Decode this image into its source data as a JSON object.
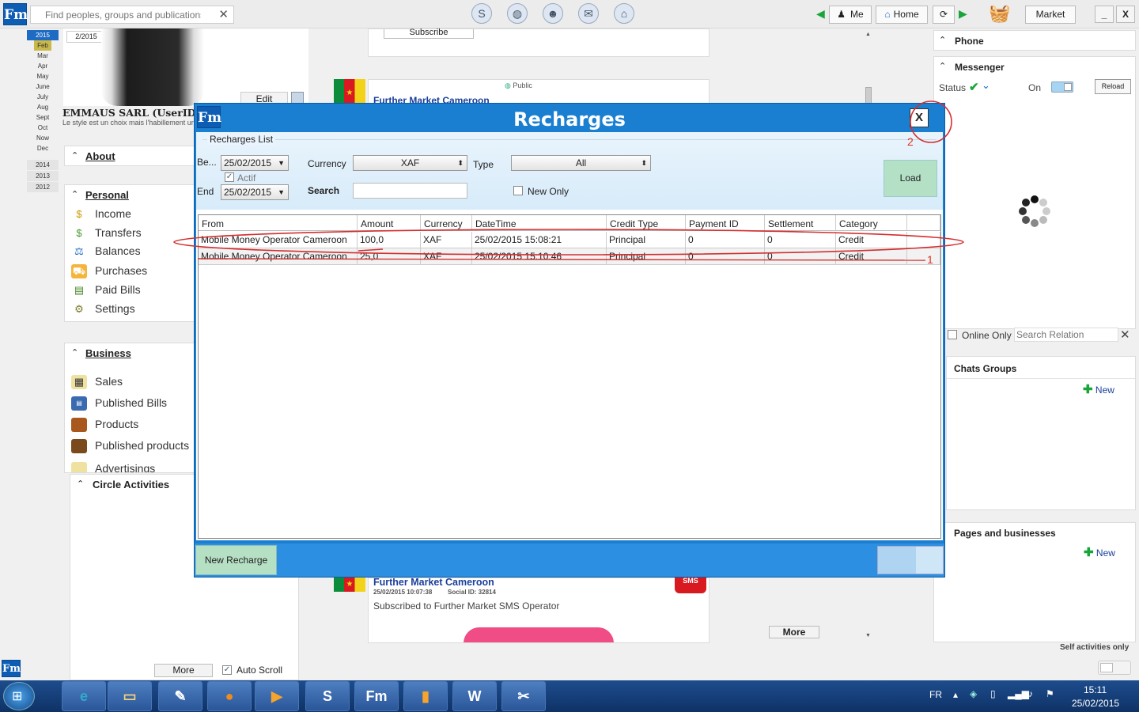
{
  "topbar": {
    "logo": "Fm",
    "search_placeholder": "Find peoples, groups and publications",
    "me_label": "Me",
    "home_label": "Home",
    "market_label": "Market",
    "minimize": "_",
    "close": "X"
  },
  "calendar": {
    "year_selected": "2015",
    "months": [
      "Feb",
      "Mar",
      "Apr",
      "May",
      "June",
      "July",
      "Aug",
      "Sept",
      "Oct",
      "Now",
      "Dec"
    ],
    "month_selected": "Feb",
    "years": [
      "2014",
      "2013",
      "2012"
    ]
  },
  "profile": {
    "date": "2/2015",
    "edit": "Edit",
    "name": "EMMAUS SARL (UserID=81",
    "tagline": "Le style est un choix mais l'habillement ur"
  },
  "left": {
    "about": "About",
    "personal": "Personal",
    "personal_items": [
      "Income",
      "Transfers",
      "Balances",
      "Purchases",
      "Paid Bills",
      "Settings"
    ],
    "business": "Business",
    "business_items": [
      "Sales",
      "Published Bills",
      "Products",
      "Published products",
      "Advertisings"
    ],
    "circle": "Circle Activities",
    "more": "More",
    "auto_scroll": "Auto Scroll"
  },
  "feed": {
    "subscribe": "Subscribe",
    "public": "Public",
    "card1_title": "Further Market Cameroon",
    "card2_title": "Further Market Cameroon",
    "card2_meta_date": "25/02/2015 10:07:38",
    "card2_meta_social": "Social ID: 32814",
    "card2_text": "Subscribed to Further Market SMS Operator",
    "sms": "SMS",
    "more": "More"
  },
  "dialog": {
    "title": "Recharges",
    "close": "X",
    "group_label": "Recharges List",
    "begin_label": "Be...",
    "begin_value": "25/02/2015",
    "actif": "Actif",
    "end_label": "End",
    "end_value": "25/02/2015",
    "currency_label": "Currency",
    "currency_value": "XAF",
    "search_label": "Search",
    "type_label": "Type",
    "type_value": "All",
    "new_only": "New Only",
    "load": "Load",
    "columns": [
      "From",
      "Amount",
      "Currency",
      "DateTime",
      "Credit Type",
      "Payment ID",
      "Settlement",
      "Category"
    ],
    "rows": [
      {
        "from": "Mobile Money Operator Cameroon",
        "amount": "100,0",
        "currency": "XAF",
        "datetime": "25/02/2015 15:08:21",
        "credit_type": "Principal",
        "payment_id": "0",
        "settlement": "0",
        "category": "Credit"
      },
      {
        "from": "Mobile Money Operator Cameroon",
        "amount": "25,0",
        "currency": "XAF",
        "datetime": "25/02/2015 15:10:46",
        "credit_type": "Principal",
        "payment_id": "0",
        "settlement": "0",
        "category": "Credit"
      }
    ],
    "new_recharge": "New Recharge"
  },
  "annotations": {
    "one": "1",
    "two": "2",
    "color": "#d32f2f"
  },
  "right": {
    "phone": "Phone",
    "messenger": "Messenger",
    "status_label": "Status",
    "on_label": "On",
    "reload": "Reload",
    "online_only": "Online Only",
    "search_relation_placeholder": "Search Relation",
    "chats_groups": "Chats Groups",
    "new1": "New",
    "pages_businesses": "Pages and businesses",
    "new2": "New",
    "self_activities": "Self activities only"
  },
  "taskbar": {
    "lang": "FR",
    "time": "15:11",
    "date": "25/02/2015"
  }
}
